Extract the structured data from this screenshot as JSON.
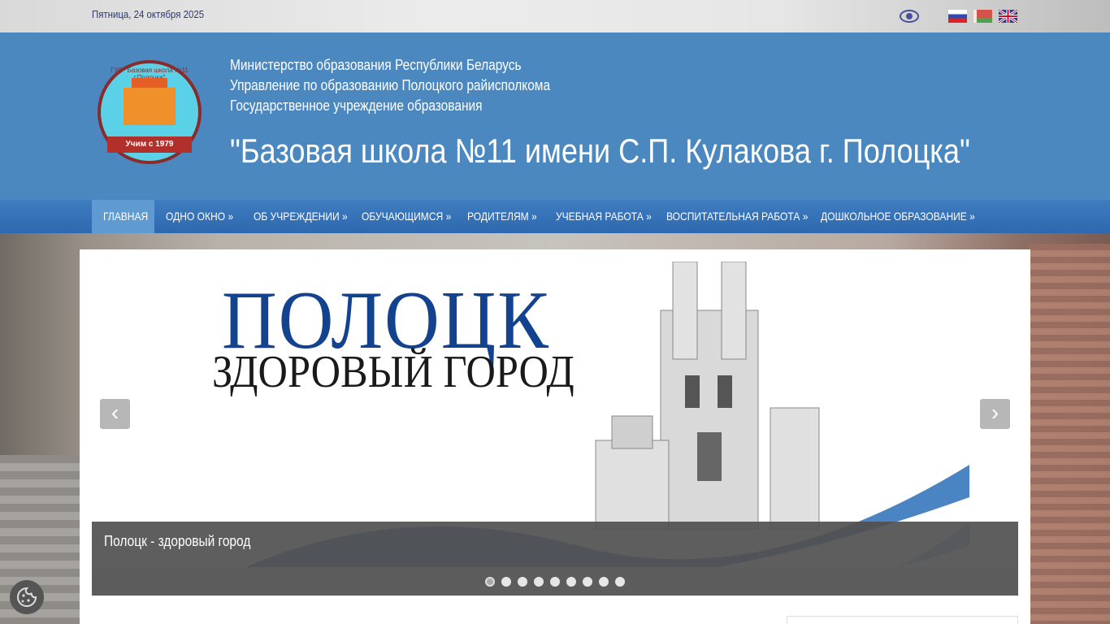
{
  "topbar": {
    "date": "Пятница, 24 октября 2025",
    "accessibility_icon": "eye-icon",
    "languages": [
      "ru-flag",
      "by-flag",
      "en-flag"
    ]
  },
  "header": {
    "line1": "Министерство образования Республики Беларусь",
    "line2": "Управление по образованию Полоцкого райисполкома",
    "line3": "Государственное учреждение образования",
    "title": "\"Базовая школа №11 имени С.П. Кулакова г. Полоцка\"",
    "logo": {
      "ring_text": "ГУО \"Базовая школа №11 г.Полоцка\"",
      "ribbon_text": "Учим с 1979"
    }
  },
  "nav": {
    "items": [
      {
        "label": "ГЛАВНАЯ",
        "active": true
      },
      {
        "label": "ОДНО ОКНО »"
      },
      {
        "label": "ОБ УЧРЕЖДЕНИИ »"
      },
      {
        "label": "ОБУЧАЮЩИМСЯ »"
      },
      {
        "label": "РОДИТЕЛЯМ »"
      },
      {
        "label": "УЧЕБНАЯ РАБОТА »"
      },
      {
        "label": "ВОСПИТАТЕЛЬНАЯ РАБОТА »"
      },
      {
        "label": "ДОШКОЛЬНОЕ ОБРАЗОВАНИЕ »"
      }
    ]
  },
  "slider": {
    "heading1": "ПОЛОЦК",
    "heading2": "ЗДОРОВЫЙ ГОРОД",
    "caption": "Полоцк - здоровый город",
    "prev_label": "‹",
    "next_label": "›",
    "slide_count": 9,
    "active_slide": 1
  },
  "colors": {
    "header_bg": "#4c88c0",
    "nav_bg": "#2e68ae",
    "nav_active": "#5f9ad0",
    "brand_blue": "#13428f"
  }
}
